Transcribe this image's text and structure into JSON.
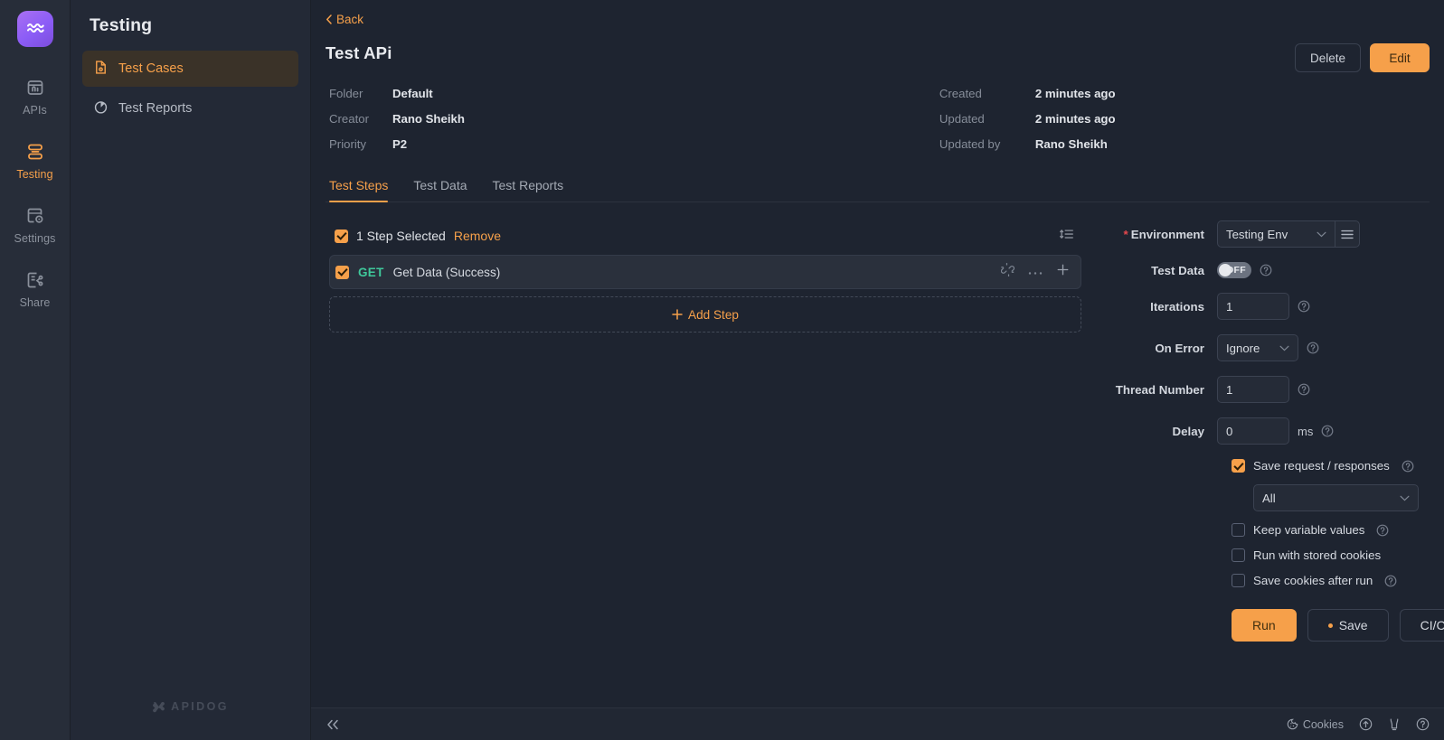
{
  "rail": {
    "logo_icon": "aquarius-logo-icon",
    "items": [
      {
        "label": "APIs",
        "icon": "apis-icon",
        "active": false
      },
      {
        "label": "Testing",
        "icon": "testing-icon",
        "active": true
      },
      {
        "label": "Settings",
        "icon": "settings-icon",
        "active": false
      },
      {
        "label": "Share",
        "icon": "share-icon",
        "active": false
      }
    ]
  },
  "sidebar": {
    "title": "Testing",
    "items": [
      {
        "label": "Test Cases",
        "icon": "test-case-file-icon"
      },
      {
        "label": "Test Reports",
        "icon": "pie-chart-icon"
      }
    ],
    "brand": "APIDOG"
  },
  "header": {
    "back_label": "Back",
    "title": "Test APi",
    "delete_label": "Delete",
    "edit_label": "Edit",
    "meta_left": [
      {
        "key": "Folder",
        "value": "Default"
      },
      {
        "key": "Creator",
        "value": "Rano Sheikh"
      },
      {
        "key": "Priority",
        "value": "P2"
      }
    ],
    "meta_right": [
      {
        "key": "Created",
        "value": "2 minutes ago"
      },
      {
        "key": "Updated",
        "value": "2 minutes ago"
      },
      {
        "key": "Updated by",
        "value": "Rano Sheikh"
      }
    ]
  },
  "tabs": [
    {
      "label": "Test Steps",
      "active": true
    },
    {
      "label": "Test Data",
      "active": false
    },
    {
      "label": "Test Reports",
      "active": false
    }
  ],
  "steps": {
    "selected_text": "1 Step Selected",
    "remove_label": "Remove",
    "sort_icon": "sort-list-icon",
    "rows": [
      {
        "checked": true,
        "method": "GET",
        "name": "Get Data (Success)",
        "icons": [
          "unlink-icon",
          "more-ellipsis-icon",
          "add-plus-icon"
        ]
      }
    ],
    "add_step_label": "Add Step"
  },
  "config": {
    "environment": {
      "label": "Environment",
      "required": true,
      "value": "Testing Env",
      "manage_icon": "menu-lines-icon"
    },
    "test_data": {
      "label": "Test Data",
      "toggle_state": "OFF"
    },
    "iterations": {
      "label": "Iterations",
      "value": "1"
    },
    "on_error": {
      "label": "On Error",
      "value": "Ignore"
    },
    "thread_number": {
      "label": "Thread Number",
      "value": "1"
    },
    "delay": {
      "label": "Delay",
      "value": "0",
      "unit": "ms"
    },
    "checkboxes": [
      {
        "label": "Save request / responses",
        "checked": true,
        "has_help": true
      },
      {
        "label": "Keep variable values",
        "checked": false,
        "has_help": true
      },
      {
        "label": "Run with stored cookies",
        "checked": false,
        "has_help": false
      },
      {
        "label": "Save cookies after run",
        "checked": false,
        "has_help": true
      }
    ],
    "save_scope": {
      "value": "All"
    },
    "actions": {
      "run_label": "Run",
      "save_label": "Save",
      "cicd_label": "CI/CD"
    }
  },
  "statusbar": {
    "collapse_icon": "collapse-left-icon",
    "cookies_label": "Cookies",
    "icons": [
      "upload-circle-icon",
      "lightbulb-icon",
      "help-circle-icon"
    ]
  },
  "colors": {
    "accent": "#f6a04a",
    "method_get": "#3fc89b",
    "required_star": "#e5484d",
    "app_bg": "#1e2430",
    "panel_bg": "#232936"
  }
}
